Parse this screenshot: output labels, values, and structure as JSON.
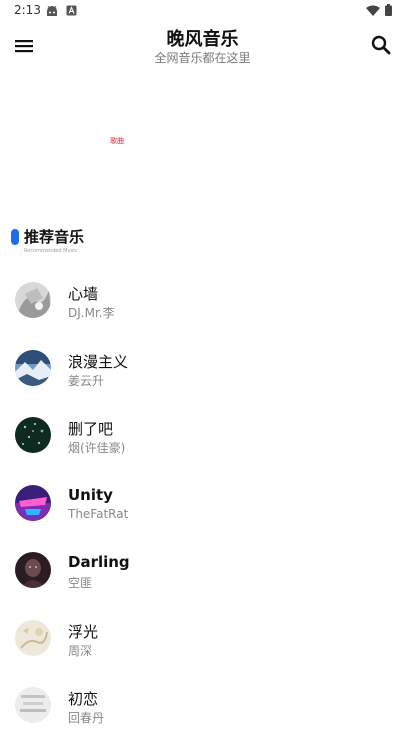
{
  "status_bar": {
    "time": "2:13",
    "icons": [
      "android-icon",
      "notification-a-icon",
      "wifi-icon",
      "battery-icon"
    ]
  },
  "app_bar": {
    "title": "晚风音乐",
    "subtitle": "全网音乐都在这里",
    "menu_icon": "menu-icon",
    "search_icon": "search-icon"
  },
  "banner": {
    "tag": "歌曲"
  },
  "section": {
    "title": "推荐音乐",
    "subtitle": "Recommended Music",
    "accent_color": "#1e6ff0"
  },
  "songs": [
    {
      "title": "心墙",
      "artist": "DJ.Mr.李"
    },
    {
      "title": "浪漫主义",
      "artist": "姜云升"
    },
    {
      "title": "删了吧",
      "artist": "烟(许佳豪)"
    },
    {
      "title": "Unity",
      "artist": "TheFatRat"
    },
    {
      "title": "Darling",
      "artist": "空匪"
    },
    {
      "title": "浮光",
      "artist": "周深"
    },
    {
      "title": "初恋",
      "artist": "回春丹"
    }
  ]
}
